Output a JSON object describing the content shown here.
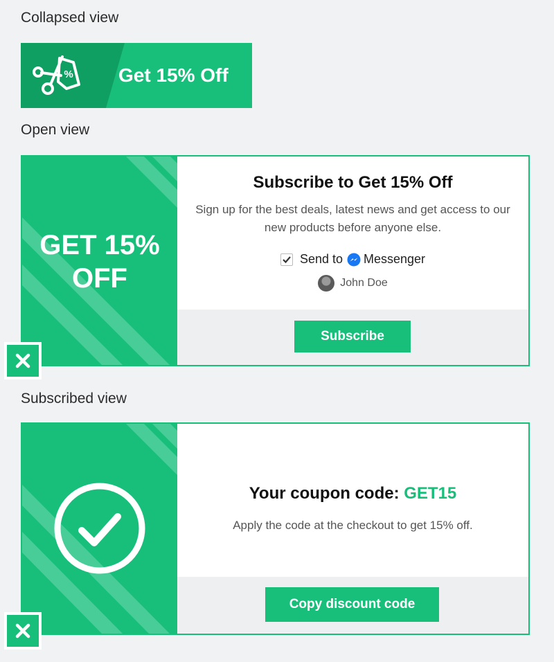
{
  "collapsed": {
    "label": "Collapsed view",
    "title": "Get 15% Off"
  },
  "open": {
    "label": "Open view",
    "banner": [
      "GET 15%",
      "OFF"
    ],
    "heading": "Subscribe to Get 15% Off",
    "description_lines": [
      "Sign up for the best deals, latest news and get access to our",
      "new products before anyone else."
    ],
    "checkbox_checked": true,
    "send_to": "Send to",
    "messenger": "Messenger",
    "user_name": "John Doe",
    "button": "Subscribe"
  },
  "subscribed": {
    "label": "Subscribed view",
    "heading_prefix": "Your coupon code: ",
    "code": "GET15",
    "description": "Apply the code at the checkout to get 15% off.",
    "button": "Copy discount code"
  },
  "colors": {
    "accent": "#17bf7b",
    "accent_dark": "#0f9f63",
    "background": "#f1f2f4",
    "messenger_blue": "#1877f2"
  }
}
